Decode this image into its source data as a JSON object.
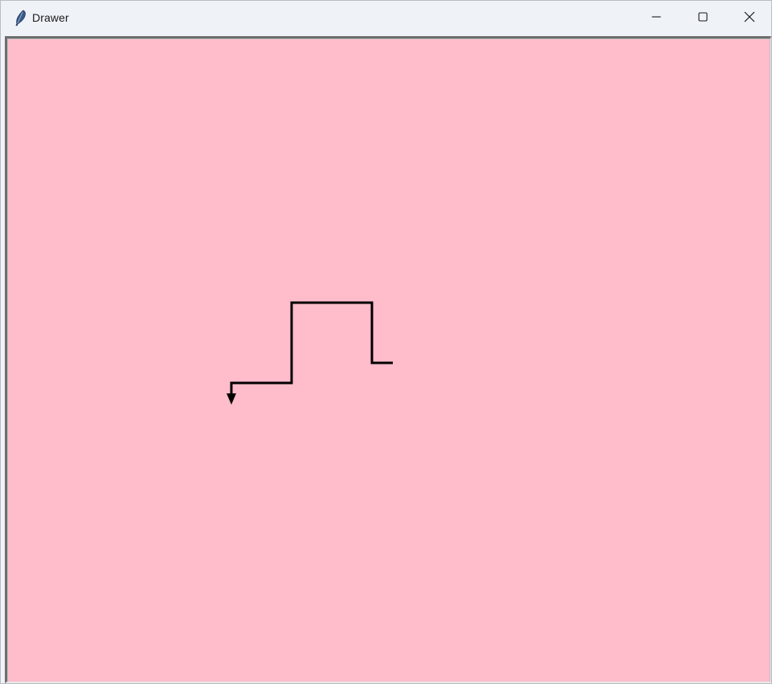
{
  "window": {
    "title": "Drawer",
    "app_icon": "feather-icon",
    "controls": {
      "minimize_icon": "minimize-icon",
      "maximize_icon": "maximize-icon",
      "close_icon": "close-icon"
    }
  },
  "canvas": {
    "background_color": "#ffbccb",
    "stroke_color": "#000000",
    "cursor_icon": "turtle-arrow-icon"
  }
}
